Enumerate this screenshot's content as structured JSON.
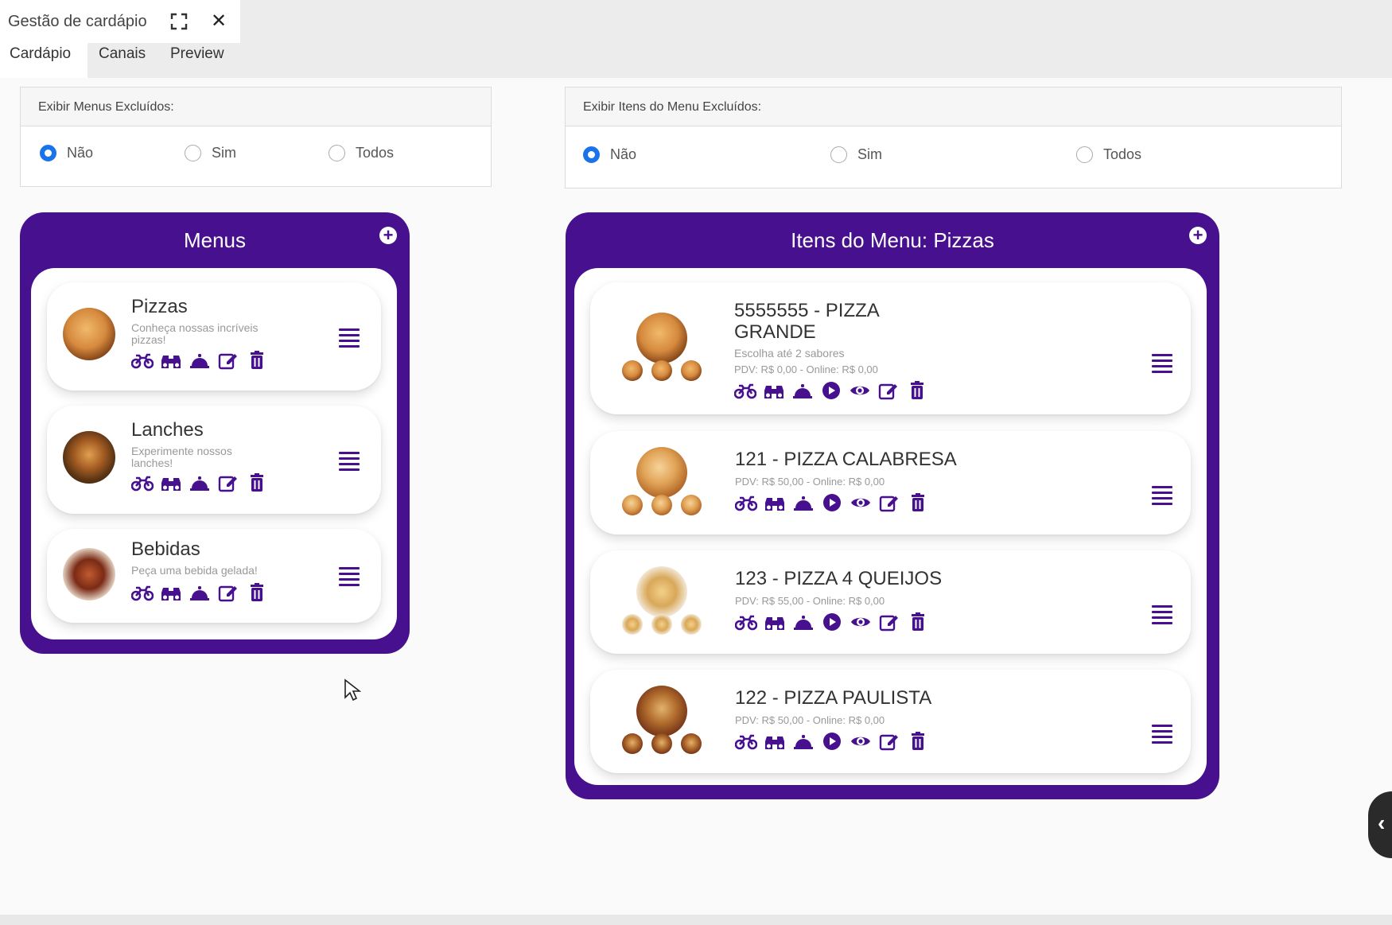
{
  "window": {
    "title": "Gestão de cardápio",
    "expand_icon": "expand-icon",
    "close_symbol": "✕"
  },
  "tabs": [
    {
      "label": "Cardápio",
      "active": true
    },
    {
      "label": "Canais",
      "active": false
    },
    {
      "label": "Preview",
      "active": false
    }
  ],
  "filters": {
    "menus": {
      "title": "Exibir Menus Excluídos:",
      "options": [
        "Não",
        "Sim",
        "Todos"
      ],
      "selected": "Não"
    },
    "items": {
      "title": "Exibir Itens do Menu Excluídos:",
      "options": [
        "Não",
        "Sim",
        "Todos"
      ],
      "selected": "Não"
    }
  },
  "menus_panel": {
    "title": "Menus",
    "add_symbol": "+",
    "menus": [
      {
        "name": "Pizzas",
        "description": "Conheça nossas incríveis pizzas!",
        "image": "pizza-image"
      },
      {
        "name": "Lanches",
        "description": "Experimente nossos lanches!",
        "image": "burger-image"
      },
      {
        "name": "Bebidas",
        "description": "Peça uma bebida gelada!",
        "image": "drink-image"
      }
    ],
    "action_icons": [
      "motorcycle-icon",
      "binoculars-icon",
      "cloche-icon",
      "edit-icon",
      "trash-icon"
    ]
  },
  "items_panel": {
    "title": "Itens do Menu: Pizzas",
    "add_symbol": "+",
    "items": [
      {
        "name_line1": "5555555 - PIZZA",
        "name_line2": "GRANDE",
        "description": "Escolha até 2 sabores",
        "price": "PDV: R$ 0,00 - Online: R$ 0,00"
      },
      {
        "name_line1": "121 - PIZZA CALABRESA",
        "name_line2": "",
        "description": "",
        "price": "PDV: R$ 50,00 - Online: R$ 0,00"
      },
      {
        "name_line1": "123 - PIZZA 4 QUEIJOS",
        "name_line2": "",
        "description": "",
        "price": "PDV: R$ 55,00 - Online: R$ 0,00"
      },
      {
        "name_line1": "122 - PIZZA PAULISTA",
        "name_line2": "",
        "description": "",
        "price": "PDV: R$ 50,00 - Online: R$ 0,00"
      }
    ],
    "action_icons": [
      "motorcycle-icon",
      "binoculars-icon",
      "cloche-icon",
      "play-icon",
      "eye-icon",
      "edit-icon",
      "trash-icon"
    ]
  },
  "side_handle_symbol": "‹",
  "colors": {
    "brand_purple": "#46108e",
    "radio_selected": "#1a73e8"
  }
}
